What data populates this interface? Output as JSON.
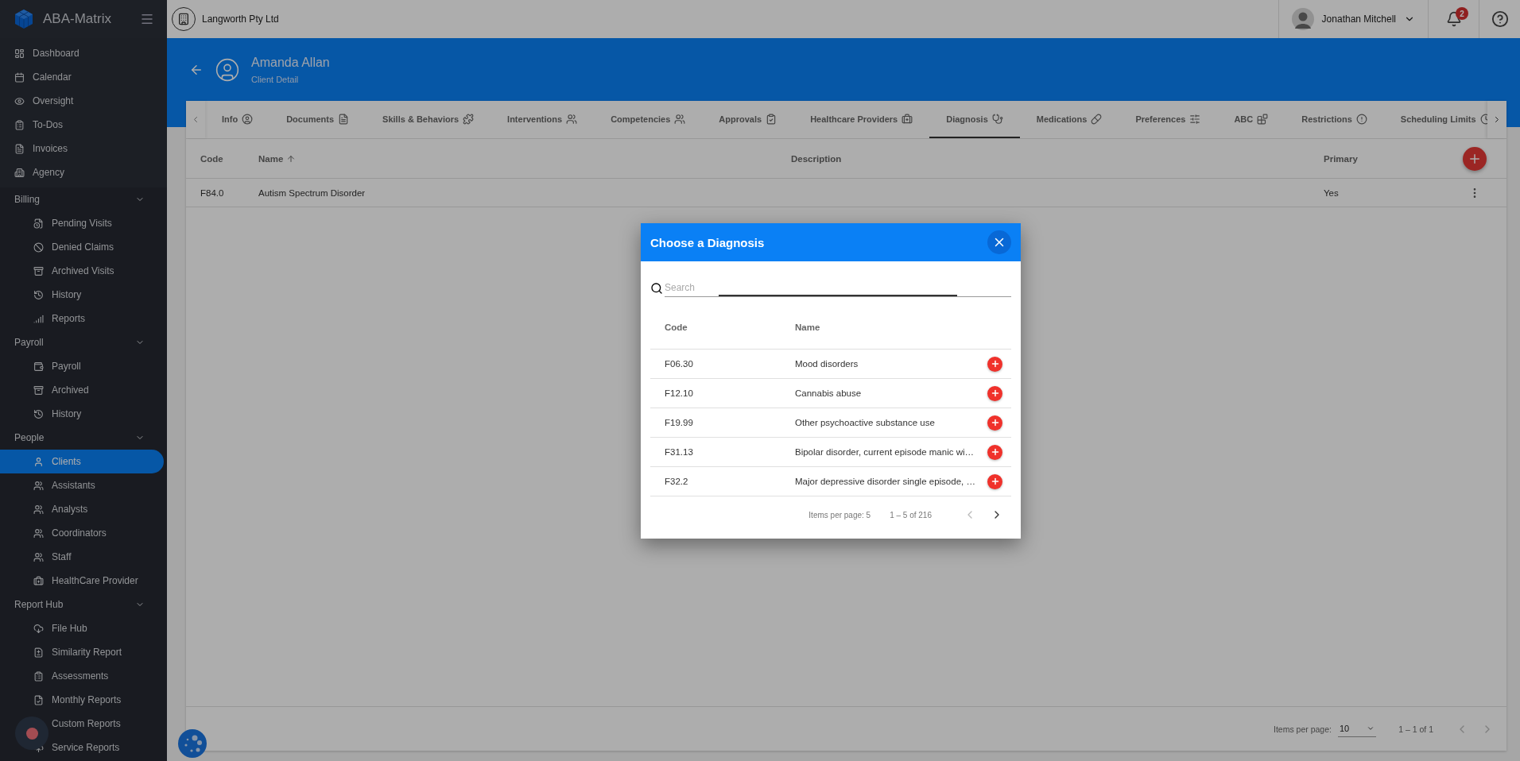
{
  "app": {
    "name": "ABA-Matrix"
  },
  "sidebar": {
    "items": [
      {
        "label": "Dashboard",
        "selected": false
      },
      {
        "label": "Calendar",
        "selected": false
      },
      {
        "label": "Oversight",
        "selected": false
      },
      {
        "label": "To-Dos",
        "selected": false
      },
      {
        "label": "Invoices",
        "selected": false
      },
      {
        "label": "Agency",
        "selected": false
      }
    ],
    "sections": [
      {
        "title": "Billing",
        "expanded": true,
        "items": [
          {
            "label": "Pending Visits",
            "selected": false
          },
          {
            "label": "Denied Claims",
            "selected": false
          },
          {
            "label": "Archived Visits",
            "selected": false
          },
          {
            "label": "History",
            "selected": false
          },
          {
            "label": "Reports",
            "selected": false
          }
        ]
      },
      {
        "title": "Payroll",
        "expanded": true,
        "items": [
          {
            "label": "Payroll",
            "selected": false
          },
          {
            "label": "Archived",
            "selected": false
          },
          {
            "label": "History",
            "selected": false
          }
        ]
      },
      {
        "title": "People",
        "expanded": true,
        "items": [
          {
            "label": "Clients",
            "selected": true
          },
          {
            "label": "Assistants",
            "selected": false
          },
          {
            "label": "Analysts",
            "selected": false
          },
          {
            "label": "Coordinators",
            "selected": false
          },
          {
            "label": "Staff",
            "selected": false
          },
          {
            "label": "HealthCare Provider",
            "selected": false
          }
        ]
      },
      {
        "title": "Report Hub",
        "expanded": true,
        "items": [
          {
            "label": "File Hub",
            "selected": false
          },
          {
            "label": "Similarity Report",
            "selected": false
          },
          {
            "label": "Assessments",
            "selected": false
          },
          {
            "label": "Monthly Reports",
            "selected": false
          },
          {
            "label": "Custom Reports",
            "selected": false
          },
          {
            "label": "Service Reports",
            "selected": false
          }
        ]
      }
    ]
  },
  "topbar": {
    "organization": "Langworth Pty Ltd",
    "user": "Jonathan Mitchell",
    "notifications": "2"
  },
  "client": {
    "name": "Amanda Allan",
    "subtitle": "Client Detail"
  },
  "tabs": [
    {
      "label": "Info",
      "selected": false
    },
    {
      "label": "Documents",
      "selected": false
    },
    {
      "label": "Skills & Behaviors",
      "selected": false
    },
    {
      "label": "Interventions",
      "selected": false
    },
    {
      "label": "Competencies",
      "selected": false
    },
    {
      "label": "Approvals",
      "selected": false
    },
    {
      "label": "Healthcare Providers",
      "selected": false
    },
    {
      "label": "Diagnosis",
      "selected": true
    },
    {
      "label": "Medications",
      "selected": false
    },
    {
      "label": "Preferences",
      "selected": false
    },
    {
      "label": "ABC",
      "selected": false
    },
    {
      "label": "Restrictions",
      "selected": false
    },
    {
      "label": "Scheduling Limits",
      "selected": false
    }
  ],
  "table": {
    "columns": [
      {
        "label": "Code",
        "sorted": false
      },
      {
        "label": "Name",
        "sorted": true
      },
      {
        "label": "Description",
        "sorted": false
      },
      {
        "label": "Primary",
        "sorted": false
      }
    ],
    "rows": [
      {
        "code": "F84.0",
        "name": "Autism Spectrum Disorder",
        "primary": "Yes"
      }
    ],
    "pagination": {
      "label": "Items per page:",
      "page_size": "10",
      "range": "1 – 1 of 1"
    }
  },
  "dialog": {
    "title": "Choose a Diagnosis",
    "search": {
      "placeholder": "Search"
    },
    "columns": [
      "Code",
      "Name"
    ],
    "rows": [
      {
        "code": "F06.30",
        "name": "Mood disorders"
      },
      {
        "code": "F12.10",
        "name": "Cannabis abuse"
      },
      {
        "code": "F19.99",
        "name": "Other psychoactive substance use"
      },
      {
        "code": "F31.13",
        "name": "Bipolar disorder, current episode manic wi…"
      },
      {
        "code": "F32.2",
        "name": "Major depressive disorder single episode, …"
      }
    ],
    "pagination": {
      "label": "Items per page: 5",
      "range": "1 – 5 of 216"
    }
  }
}
